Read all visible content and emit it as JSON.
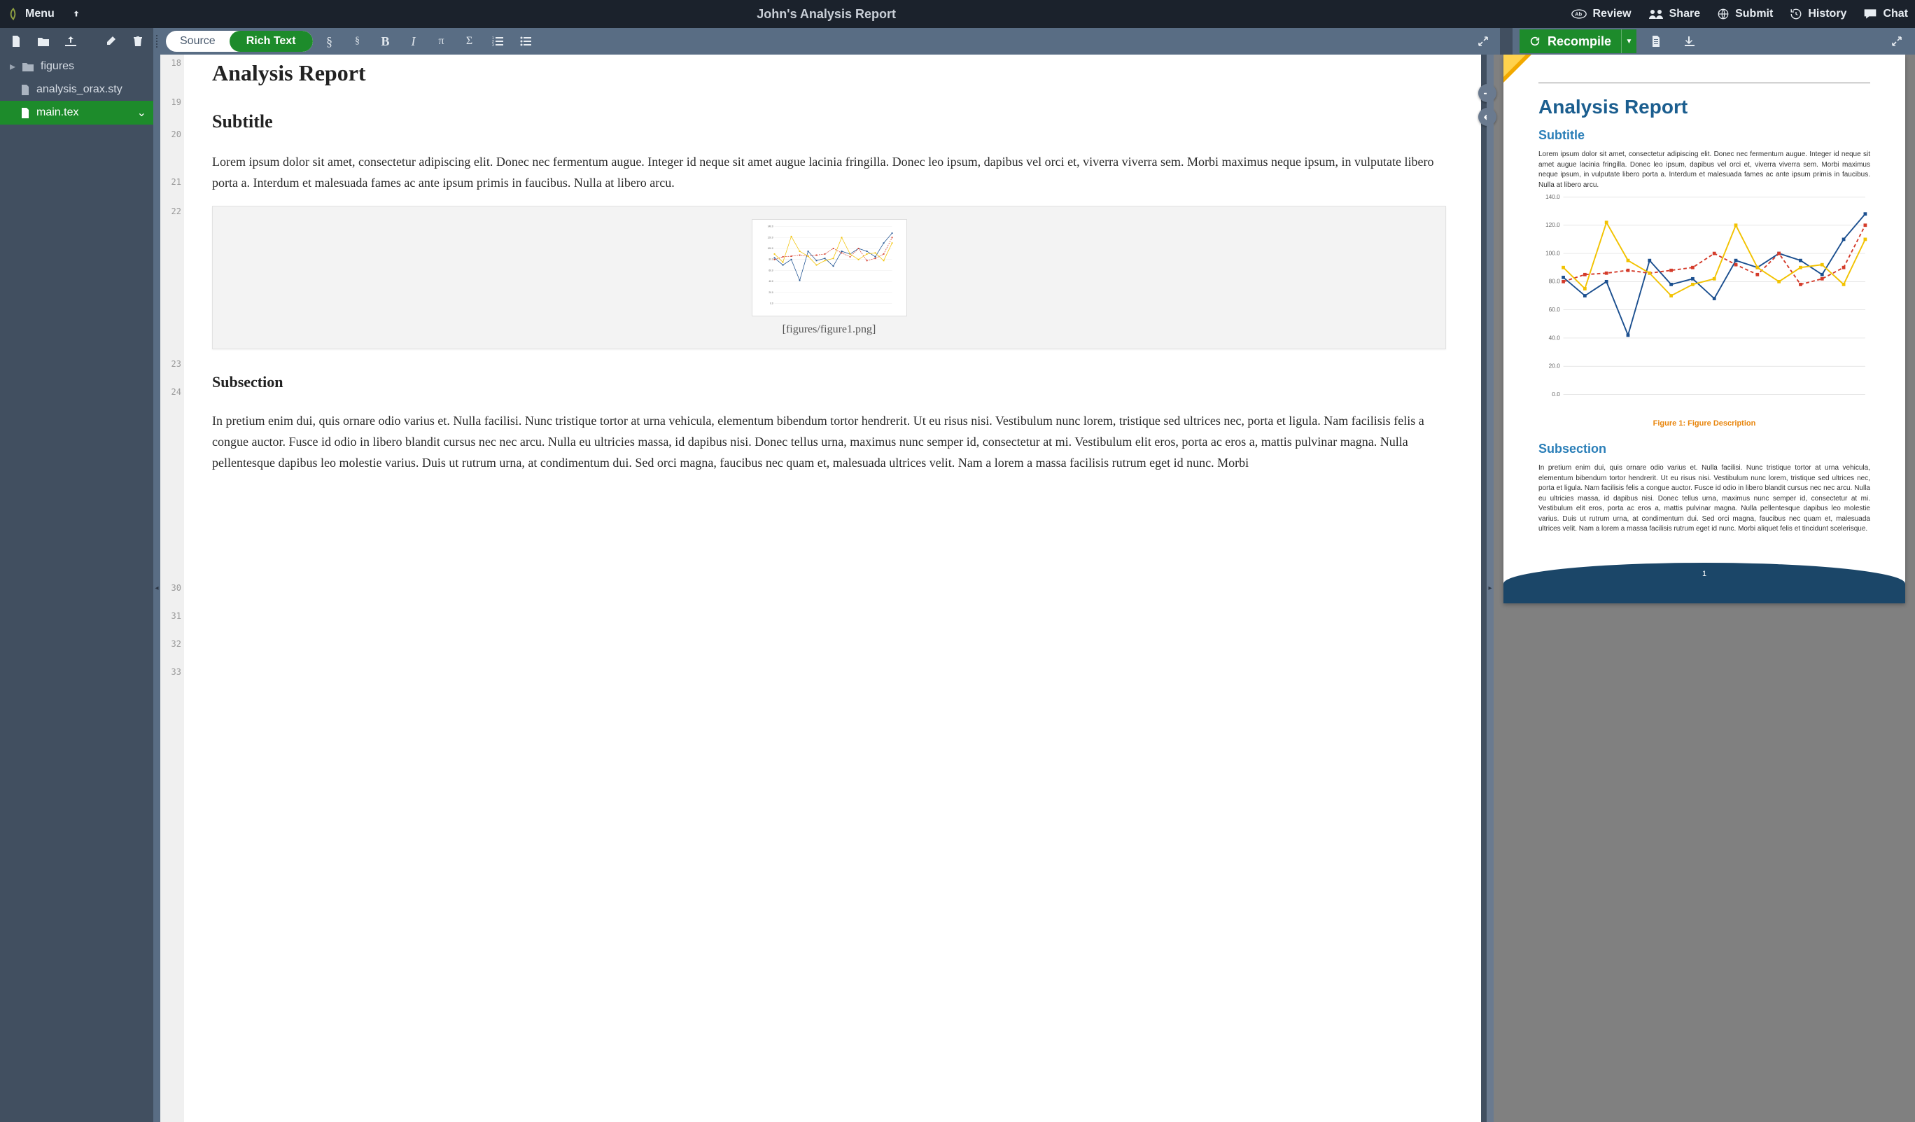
{
  "header": {
    "menu": "Menu",
    "title": "John's Analysis Report",
    "review": "Review",
    "share": "Share",
    "submit": "Submit",
    "history": "History",
    "chat": "Chat"
  },
  "toolbar": {
    "source": "Source",
    "rich": "Rich Text",
    "recompile": "Recompile"
  },
  "files": {
    "figures": "figures",
    "sty": "analysis_orax.sty",
    "main": "main.tex"
  },
  "lineNumbers": [
    "18",
    "",
    "19",
    "",
    "20",
    "",
    "",
    "21",
    "",
    "22",
    "",
    "",
    "",
    "",
    "",
    "",
    "",
    "",
    "",
    "23",
    "",
    "24",
    "",
    "",
    "",
    "",
    "",
    "",
    "",
    "",
    "",
    "",
    "",
    "",
    "",
    "30",
    "",
    "31",
    "",
    "32",
    "",
    "33"
  ],
  "editor": {
    "title": "Analysis Report",
    "subtitle": "Subtitle",
    "para1": "Lorem ipsum dolor sit amet, consectetur adipiscing elit. Donec nec fermentum augue. Integer id neque sit amet augue lacinia fringilla. Donec leo ipsum, dapibus vel orci et, viverra viverra sem. Morbi maximus neque ipsum, in vulputate libero porta a. Interdum et malesuada fames ac ante ipsum primis in faucibus. Nulla at libero arcu.",
    "figcap": "[figures/figure1.png]",
    "subsection": "Subsection",
    "para2": "In pretium enim dui, quis ornare odio varius et. Nulla facilisi. Nunc tristique tortor at urna vehicula, elementum bibendum tortor hendrerit. Ut eu risus nisi. Vestibulum nunc lorem, tristique sed ultrices nec, porta et ligula. Nam facilisis felis a congue auctor. Fusce id odio in libero blandit cursus nec nec arcu. Nulla eu ultricies massa, id dapibus nisi. Donec tellus urna, maximus nunc semper id, consectetur at mi. Vestibulum elit eros, porta ac eros a, mattis pulvinar magna. Nulla pellentesque dapibus leo molestie varius. Duis ut rutrum urna, at condimentum dui. Sed orci magna, faucibus nec quam et, malesuada ultrices velit. Nam a lorem a massa facilisis rutrum eget id nunc. Morbi"
  },
  "preview": {
    "title": "Analysis Report",
    "subtitle": "Subtitle",
    "para1": "Lorem ipsum dolor sit amet, consectetur adipiscing elit. Donec nec fermentum augue. Integer id neque sit amet augue lacinia fringilla. Donec leo ipsum, dapibus vel orci et, viverra viverra sem. Morbi maximus neque ipsum, in vulputate libero porta a. Interdum et malesuada fames ac ante ipsum primis in faucibus. Nulla at libero arcu.",
    "figcaption": "Figure 1: Figure Description",
    "subsection": "Subsection",
    "para2": "In pretium enim dui, quis ornare odio varius et. Nulla facilisi. Nunc tristique tortor at urna vehicula, elementum bibendum tortor hendrerit. Ut eu risus nisi. Vestibulum nunc lorem, tristique sed ultrices nec, porta et ligula. Nam facilisis felis a congue auctor. Fusce id odio in libero blandit cursus nec nec arcu. Nulla eu ultricies massa, id dapibus nisi. Donec tellus urna, maximus nunc semper id, consectetur at mi. Vestibulum elit eros, porta ac eros a, mattis pulvinar magna. Nulla pellentesque dapibus leo molestie varius. Duis ut rutrum urna, at condimentum dui. Sed orci magna, faucibus nec quam et, malesuada ultrices velit. Nam a lorem a massa facilisis rutrum eget id nunc. Morbi aliquet felis et tincidunt scelerisque.",
    "pagenum": "1"
  },
  "chart_data": {
    "type": "line",
    "x": [
      1,
      2,
      3,
      4,
      5,
      6,
      7,
      8,
      9,
      10,
      11,
      12,
      13,
      14,
      15
    ],
    "series": [
      {
        "name": "blue",
        "color": "#1b4f8f",
        "style": "solid",
        "values": [
          83,
          70,
          80,
          42,
          95,
          78,
          82,
          68,
          95,
          90,
          100,
          95,
          85,
          110,
          128
        ]
      },
      {
        "name": "red",
        "color": "#d43b2a",
        "style": "dashed",
        "values": [
          80,
          85,
          86,
          88,
          86,
          88,
          90,
          100,
          92,
          85,
          100,
          78,
          82,
          90,
          120
        ]
      },
      {
        "name": "yellow",
        "color": "#f2c200",
        "style": "solid",
        "values": [
          90,
          75,
          122,
          95,
          86,
          70,
          78,
          82,
          120,
          90,
          80,
          90,
          92,
          78,
          110
        ]
      }
    ],
    "ylabels": [
      "0.0",
      "20.0",
      "40.0",
      "60.0",
      "80.0",
      "100.0",
      "120.0",
      "140.0"
    ],
    "ylim": [
      0,
      140
    ]
  }
}
